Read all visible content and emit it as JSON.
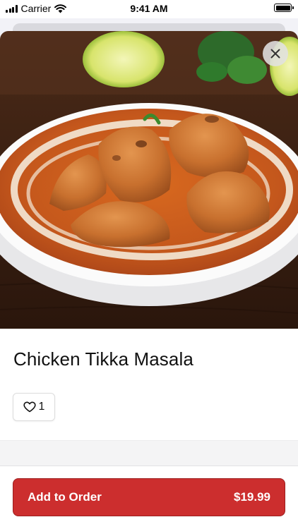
{
  "status_bar": {
    "carrier": "Carrier",
    "time": "9:41 AM",
    "battery_level": 1.0
  },
  "item": {
    "title": "Chicken Tikka Masala",
    "likes": "1",
    "image_subject": "Chicken tikka masala in a white bowl"
  },
  "actions": {
    "add_label": "Add to Order",
    "price": "$19.99"
  },
  "icons": {
    "close": "close-icon",
    "like": "heart-outline-icon",
    "wifi": "wifi-icon",
    "signal": "signal-icon",
    "battery": "battery-icon"
  },
  "colors": {
    "accent": "#cc2e2e",
    "sauce": "#c4571c",
    "cream": "#f4e9d8"
  }
}
